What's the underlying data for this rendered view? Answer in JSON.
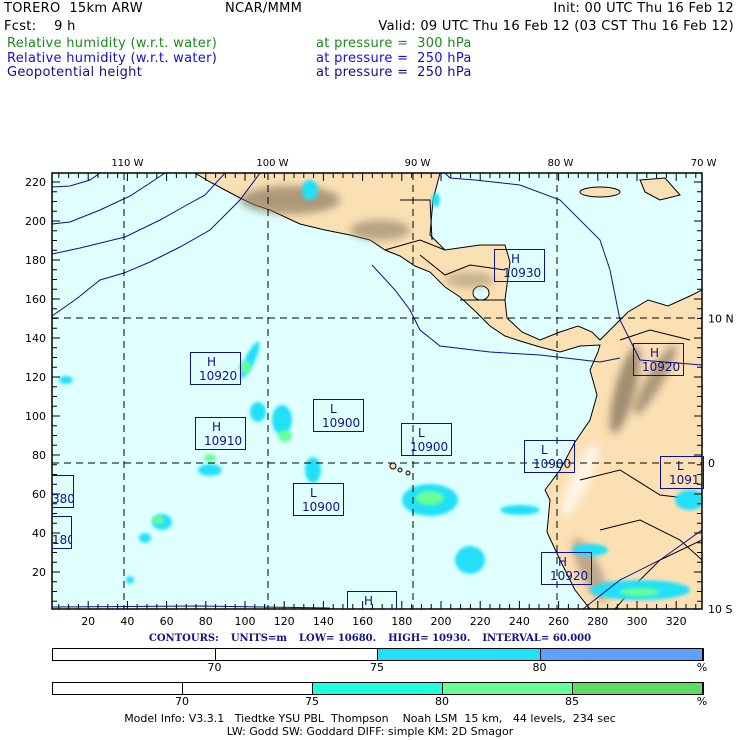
{
  "header": {
    "model": "TORERO  15km ARW",
    "org": "NCAR/MMM",
    "init": "Init: 00 UTC Thu 16 Feb 12",
    "fcst": "Fcst:    9 h",
    "valid": "Valid: 09 UTC Thu 16 Feb 12 (03 CST Thu 16 Feb 12)"
  },
  "fields": [
    {
      "name": "Relative humidity (w.r.t. water)",
      "level": "at pressure =  300 hPa",
      "color": "#1a8a1a"
    },
    {
      "name": "Relative humidity (w.r.t. water)",
      "level": "at pressure =  250 hPa",
      "color": "#1010e0"
    },
    {
      "name": "Geopotential height",
      "level": "at pressure =  250 hPa",
      "color": "#10108a"
    }
  ],
  "axes": {
    "x_ticks": [
      20,
      40,
      60,
      80,
      100,
      120,
      140,
      160,
      180,
      200,
      220,
      240,
      260,
      280,
      300,
      320
    ],
    "y_ticks": [
      20,
      40,
      60,
      80,
      100,
      120,
      140,
      160,
      180,
      200,
      220
    ],
    "lon_labels": [
      {
        "v": 40,
        "t": "110 W"
      },
      {
        "v": 114,
        "t": "100 W"
      },
      {
        "v": 188,
        "t": "90 W"
      },
      {
        "v": 261,
        "t": "80 W"
      },
      {
        "v": 334,
        "t": "70 W"
      }
    ],
    "lat_labels": [
      {
        "v": 150,
        "t": "10 N"
      },
      {
        "v": 76,
        "t": "0"
      },
      {
        "v": 1,
        "t": "10 S"
      }
    ]
  },
  "markers": [
    {
      "label": "H",
      "value": "10930"
    },
    {
      "label": "H",
      "value": "10920"
    },
    {
      "label": "H",
      "value": "10910"
    },
    {
      "label": "L",
      "value": "10900"
    },
    {
      "label": "L",
      "value": "10900"
    },
    {
      "label": "L",
      "value": "10900"
    },
    {
      "label": "L",
      "value": "10900"
    },
    {
      "label": "H",
      "value": "10920"
    },
    {
      "label": "L",
      "value": "1091"
    },
    {
      "label": "H",
      "value": "10920"
    },
    {
      "label": "",
      "value": "380"
    },
    {
      "label": "",
      "value": "180"
    },
    {
      "label": "H",
      "value": ""
    }
  ],
  "contours": {
    "title": "CONTOURS:",
    "units": "UNITS=m",
    "low": "LOW=  10680.",
    "high": "HIGH=  10930.",
    "interval": "INTERVAL=   60.000"
  },
  "colorbar_250": {
    "labels": [
      "70",
      "75",
      "80",
      "%"
    ],
    "colors": [
      "#ffffff",
      "#ffffff",
      "#22e0f8",
      "#60a0ff"
    ]
  },
  "colorbar_300": {
    "labels": [
      "70",
      "75",
      "80",
      "85",
      "%"
    ],
    "colors": [
      "#ffffff",
      "#ffffff",
      "#20ffe0",
      "#66ff99",
      "#5edc66"
    ]
  },
  "model_info": {
    "line1": "Model Info: V3.3.1   Tiedtke YSU PBL  Thompson    Noah LSM  15 km,   44 levels,  234 sec",
    "line2": "LW: Godd SW: Goddard DIFF: simple KM: 2D Smagor"
  }
}
